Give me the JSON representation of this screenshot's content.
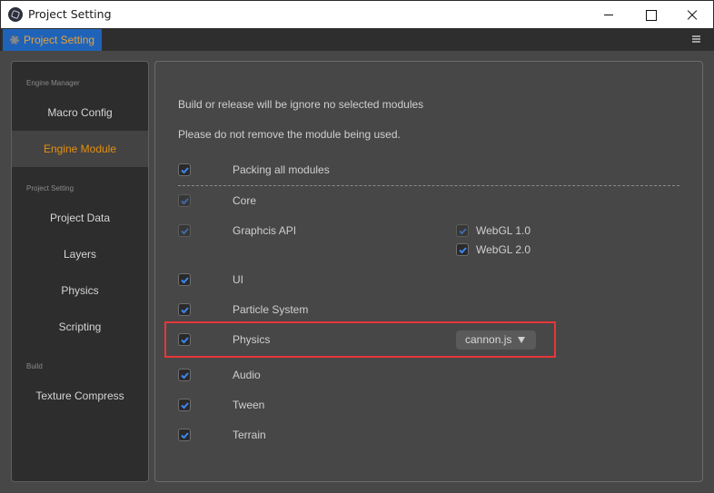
{
  "window": {
    "title": "Project Setting",
    "controls": {
      "minimize": "minimize",
      "maximize": "maximize",
      "close": "close"
    }
  },
  "tab": {
    "label": "Project Setting",
    "icon": "gear-icon"
  },
  "sidebar": {
    "groups": [
      {
        "title": "Engine Manager",
        "items": [
          {
            "label": "Macro Config",
            "active": false
          },
          {
            "label": "Engine Module",
            "active": true
          }
        ]
      },
      {
        "title": "Project Setting",
        "items": [
          {
            "label": "Project Data"
          },
          {
            "label": "Layers"
          },
          {
            "label": "Physics"
          },
          {
            "label": "Scripting"
          }
        ]
      },
      {
        "title": "Build",
        "items": [
          {
            "label": "Texture Compress"
          }
        ]
      }
    ]
  },
  "content": {
    "notes": [
      "Build or release will be ignore no selected modules",
      "Please do not remove the module being used."
    ],
    "packing_all": {
      "label": "Packing all modules",
      "checked": true
    },
    "modules": [
      {
        "label": "Core",
        "checked": true,
        "disabled": true
      },
      {
        "label": "Graphcis API",
        "checked": true,
        "disabled": true,
        "options": [
          {
            "label": "WebGL 1.0",
            "checked": true,
            "disabled": true
          },
          {
            "label": "WebGL 2.0",
            "checked": true,
            "disabled": false
          }
        ]
      },
      {
        "label": "UI",
        "checked": true
      },
      {
        "label": "Particle System",
        "checked": true
      },
      {
        "label": "Physics",
        "checked": true,
        "highlighted": true,
        "dropdown": {
          "value": "cannon.js"
        }
      },
      {
        "label": "Audio",
        "checked": true
      },
      {
        "label": "Tween",
        "checked": true
      },
      {
        "label": "Terrain",
        "checked": true
      }
    ]
  },
  "colors": {
    "accent": "#e6900d",
    "tab_bg": "#1f63b9",
    "checkmark": "#3d86f0",
    "highlight": "#e8363a"
  }
}
